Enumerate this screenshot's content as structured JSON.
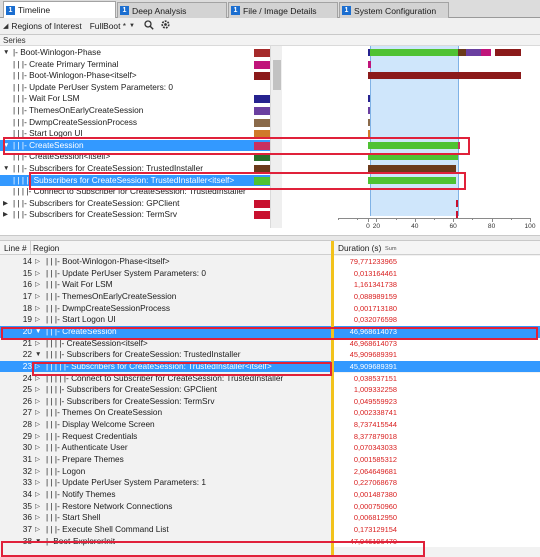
{
  "tabs": [
    {
      "num": "1",
      "label": "Timeline",
      "active": true
    },
    {
      "num": "1",
      "label": "Deep Analysis",
      "active": false
    },
    {
      "num": "1",
      "label": "File / Image Details",
      "active": false
    },
    {
      "num": "1",
      "label": "System Configuration",
      "active": false
    }
  ],
  "toolbar": {
    "roi_label": "Regions of Interest",
    "roi_value": "FullBoot *",
    "search_icon": "search-icon",
    "settings_icon": "gear-icon"
  },
  "series_header": "Series",
  "top_tree": [
    {
      "label": "|- Boot-Winlogon-Phase",
      "exp": "▼",
      "color": "#a52a2a"
    },
    {
      "label": "|   |   |- Create Primary Terminal",
      "exp": "",
      "color": "#c0147a"
    },
    {
      "label": "|   |   |- Boot-Winlogon-Phase<itself>",
      "exp": "",
      "color": "#8b1a1a"
    },
    {
      "label": "|   |   |- Update PerUser System Parameters: 0",
      "exp": "",
      "color": "#ffffff"
    },
    {
      "label": "|   |   |- Wait For LSM",
      "exp": "",
      "color": "#26228f"
    },
    {
      "label": "|   |   |- ThemesOnEarlyCreateSession",
      "exp": "",
      "color": "#6a3fa0"
    },
    {
      "label": "|   |   |- DwmpCreateSessionProcess",
      "exp": "",
      "color": "#8a6a4a"
    },
    {
      "label": "|   |   |- Start Logon UI",
      "exp": "",
      "color": "#d07a2a"
    },
    {
      "label": "|   |   |- CreateSession",
      "exp": "▼",
      "color": "#c93060",
      "selected": true
    },
    {
      "label": "|   |   |- CreateSession<itself>",
      "exp": "",
      "color": "#2a6f2a"
    },
    {
      "label": "|   |   |- Subscribers for CreateSession: TrustedInstaller",
      "exp": "▼",
      "color": "#6b3a1a"
    },
    {
      "label": "|   |   |   |- Subscribers for CreateSession: TrustedInstaller<itself>",
      "exp": "",
      "color": "#4fc233",
      "selected": true
    },
    {
      "label": "|   |   |   |- Connect to Subscriber for CreateSession: TrustedInstaller",
      "exp": "",
      "color": "#ffffff"
    },
    {
      "label": "|   |   |- Subscribers for CreateSession: GPClient",
      "exp": "▶",
      "color": "#c8102e"
    },
    {
      "label": "|   |   |- Subscribers for CreateSession: TermSrv",
      "exp": "▶",
      "color": "#c8102e"
    }
  ],
  "graph_axis_ticks": [
    "0",
    "20",
    "40",
    "60",
    "80",
    "100"
  ],
  "graph_bars": [
    {
      "segments": [
        {
          "start": 0,
          "end": 1.2,
          "color": "#26228f"
        },
        {
          "start": 1.2,
          "end": 46.9,
          "color": "#4fc233"
        },
        {
          "start": 46.9,
          "end": 51,
          "color": "#6b3a1a"
        },
        {
          "start": 51,
          "end": 59,
          "color": "#6a3fa0"
        },
        {
          "start": 59,
          "end": 64,
          "color": "#c0147a"
        },
        {
          "start": 66,
          "end": 79.8,
          "color": "#8b1a1a"
        }
      ]
    },
    {
      "segments": [
        {
          "start": 0,
          "end": 1.5,
          "color": "#c0147a"
        }
      ]
    },
    {
      "segments": [
        {
          "start": 0,
          "end": 79.8,
          "color": "#8b1a1a"
        }
      ]
    },
    {
      "segments": []
    },
    {
      "segments": [
        {
          "start": 0,
          "end": 1.2,
          "color": "#26228f"
        }
      ]
    },
    {
      "segments": [
        {
          "start": 0,
          "end": 0.5,
          "color": "#6a3fa0"
        }
      ]
    },
    {
      "segments": [
        {
          "start": 0,
          "end": 0.5,
          "color": "#8a6a4a"
        }
      ]
    },
    {
      "segments": [
        {
          "start": 0,
          "end": 0.5,
          "color": "#d07a2a"
        }
      ]
    },
    {
      "segments": [
        {
          "start": 0,
          "end": 47.0,
          "color": "#4fc233"
        },
        {
          "start": 47.0,
          "end": 48.1,
          "color": "#c93060"
        }
      ]
    },
    {
      "segments": [
        {
          "start": 0,
          "end": 47.0,
          "color": "#4fc233"
        }
      ]
    },
    {
      "segments": [
        {
          "start": 0,
          "end": 45.9,
          "color": "#6b3a1a"
        }
      ]
    },
    {
      "segments": [
        {
          "start": 0,
          "end": 45.9,
          "color": "#4fc233"
        }
      ]
    },
    {
      "segments": []
    },
    {
      "segments": [
        {
          "start": 45.9,
          "end": 47.0,
          "color": "#c8102e"
        }
      ]
    },
    {
      "segments": [
        {
          "start": 45.9,
          "end": 46.0,
          "color": "#c8102e"
        }
      ]
    }
  ],
  "table": {
    "col_line": "Line #",
    "col_region": "Region",
    "col_duration": "Duration (s)",
    "col_duration_sub": "Sum",
    "rows": [
      {
        "line": "14",
        "exp": "▷",
        "label": "|   |   |- Boot-Winlogon-Phase<itself>",
        "duration": "79,771233965"
      },
      {
        "line": "15",
        "exp": "▷",
        "label": "|   |   |- Update PerUser System Parameters: 0",
        "duration": "0,013164461"
      },
      {
        "line": "16",
        "exp": "▷",
        "label": "|   |   |- Wait For LSM",
        "duration": "1,161341738"
      },
      {
        "line": "17",
        "exp": "▷",
        "label": "|   |   |- ThemesOnEarlyCreateSession",
        "duration": "0,088989159"
      },
      {
        "line": "18",
        "exp": "▷",
        "label": "|   |   |- DwmpCreateSessionProcess",
        "duration": "0,001713180"
      },
      {
        "line": "19",
        "exp": "▷",
        "label": "|   |   |- Start Logon UI",
        "duration": "0,032076598"
      },
      {
        "line": "20",
        "exp": "▼",
        "label": "|   |   |- CreateSession",
        "duration": "46,968614073",
        "selected": true
      },
      {
        "line": "21",
        "exp": "▷",
        "label": "|   |   |   |- CreateSession<itself>",
        "duration": "46,968614073"
      },
      {
        "line": "22",
        "exp": "▼",
        "label": "|   |   |   |- Subscribers for CreateSession: TrustedInstaller",
        "duration": "45,909689391"
      },
      {
        "line": "23",
        "exp": "▷",
        "label": "|   |   |   |   |- Subscribers for CreateSession: TrustedInstaller<itself>",
        "duration": "45,909689391",
        "selected": true
      },
      {
        "line": "24",
        "exp": "▷",
        "label": "|   |   |   |   |- Connect to Subscriber for CreateSession: TrustedInstaller",
        "duration": "0,038537151"
      },
      {
        "line": "25",
        "exp": "▷",
        "label": "|   |   |   |- Subscribers for CreateSession: GPClient",
        "duration": "1,009332258"
      },
      {
        "line": "26",
        "exp": "▷",
        "label": "|   |   |   |- Subscribers for CreateSession: TermSrv",
        "duration": "0,049559923"
      },
      {
        "line": "27",
        "exp": "▷",
        "label": "|   |   |- Themes On CreateSession",
        "duration": "0,002338741"
      },
      {
        "line": "28",
        "exp": "▷",
        "label": "|   |   |- Display Welcome Screen",
        "duration": "8,737415544"
      },
      {
        "line": "29",
        "exp": "▷",
        "label": "|   |   |- Request Credentials",
        "duration": "8,377879018"
      },
      {
        "line": "30",
        "exp": "▷",
        "label": "|   |   |- Authenticate User",
        "duration": "0,070343033"
      },
      {
        "line": "31",
        "exp": "▷",
        "label": "|   |   |- Prepare Themes",
        "duration": "0,001585312"
      },
      {
        "line": "32",
        "exp": "▷",
        "label": "|   |   |- Logon",
        "duration": "2,064649681"
      },
      {
        "line": "33",
        "exp": "▷",
        "label": "|   |   |- Update PerUser System Parameters: 1",
        "duration": "0,227068678"
      },
      {
        "line": "34",
        "exp": "▷",
        "label": "|   |   |- Notify Themes",
        "duration": "0,001487380"
      },
      {
        "line": "35",
        "exp": "▷",
        "label": "|   |   |- Restore Network Connections",
        "duration": "0,000750960"
      },
      {
        "line": "36",
        "exp": "▷",
        "label": "|   |   |- Start Shell",
        "duration": "0,006812950"
      },
      {
        "line": "37",
        "exp": "▷",
        "label": "|   |   |- Execute Shell Command List",
        "duration": "0,173129154"
      },
      {
        "line": "38",
        "exp": "▼",
        "label": "|- Boot-ExplorerInit",
        "duration": "47,946196470"
      }
    ]
  }
}
